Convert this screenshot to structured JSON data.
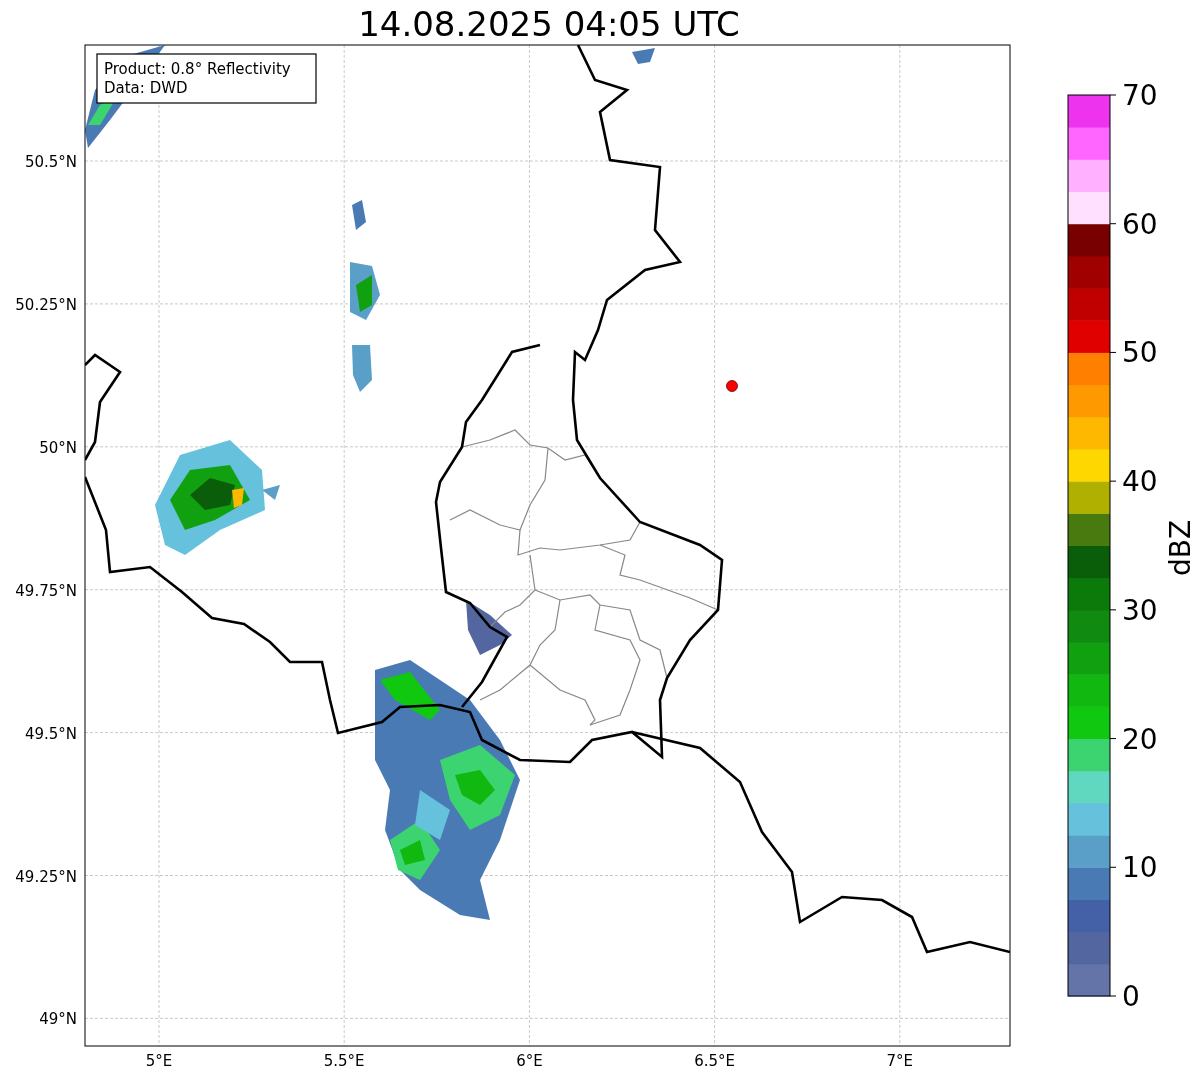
{
  "title": "14.08.2025 04:05 UTC",
  "info_box": [
    "Product: 0.8° Reflectivity",
    "Data: DWD"
  ],
  "map": {
    "lat_labels": [
      "50.5°N",
      "50.25°N",
      "50°N",
      "49.75°N",
      "49.5°N",
      "49.25°N",
      "49°N"
    ],
    "lon_labels": [
      "5°E",
      "5.5°E",
      "6°E",
      "6.5°E",
      "7°E"
    ]
  },
  "colorbar": {
    "label": "dBZ",
    "ticks": [
      "70",
      "60",
      "50",
      "40",
      "30",
      "20",
      "10",
      "0"
    ],
    "segments": [
      {
        "color": "#6473a8"
      },
      {
        "color": "#5466a0"
      },
      {
        "color": "#4460a6"
      },
      {
        "color": "#4a7ab4"
      },
      {
        "color": "#5a9fc8"
      },
      {
        "color": "#66c2dc"
      },
      {
        "color": "#60d8c0"
      },
      {
        "color": "#3cd470"
      },
      {
        "color": "#10c810"
      },
      {
        "color": "#10b810"
      },
      {
        "color": "#10a010"
      },
      {
        "color": "#108a10"
      },
      {
        "color": "#0b7a0b"
      },
      {
        "color": "#0a5e0a"
      },
      {
        "color": "#487a10"
      },
      {
        "color": "#b0b000"
      },
      {
        "color": "#ffd700"
      },
      {
        "color": "#ffb800"
      },
      {
        "color": "#ff9900"
      },
      {
        "color": "#ff7f00"
      },
      {
        "color": "#e00000"
      },
      {
        "color": "#c00000"
      },
      {
        "color": "#a00000"
      },
      {
        "color": "#780000"
      },
      {
        "color": "#ffe0ff"
      },
      {
        "color": "#ffb0ff"
      },
      {
        "color": "#ff66ff"
      },
      {
        "color": "#ee33ee"
      }
    ]
  }
}
